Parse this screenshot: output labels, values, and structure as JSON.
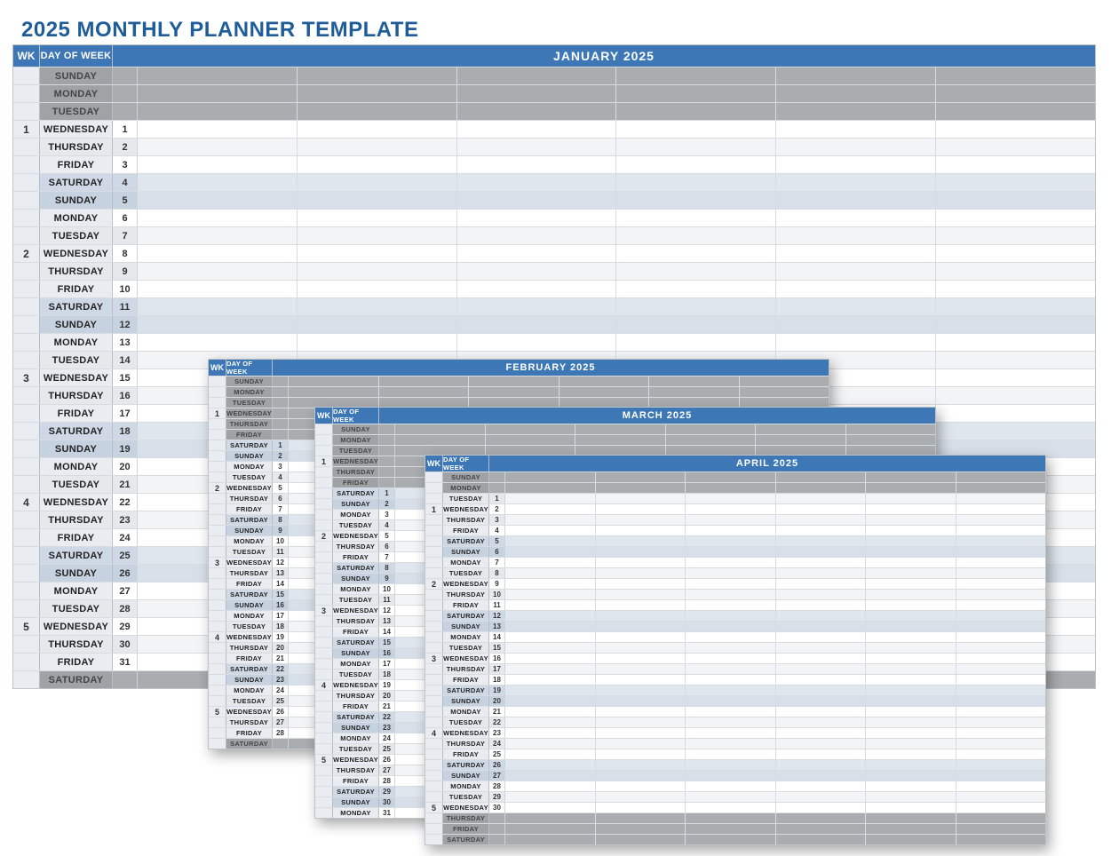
{
  "title": "2025 MONTHLY PLANNER TEMPLATE",
  "col_wk": "WK",
  "col_dow": "DAY OF WEEK",
  "slot_count": 6,
  "day_names": [
    "SUNDAY",
    "MONDAY",
    "TUESDAY",
    "WEDNESDAY",
    "THURSDAY",
    "FRIDAY",
    "SATURDAY"
  ],
  "planners": [
    {
      "id": "january",
      "class": "p0",
      "overlay": false,
      "small": false,
      "month_label": "JANUARY 2025",
      "rows": [
        {
          "wk": "",
          "dow": "SUNDAY",
          "num": "",
          "cls": "gray"
        },
        {
          "wk": "",
          "dow": "MONDAY",
          "num": "",
          "cls": "gray"
        },
        {
          "wk": "",
          "dow": "TUESDAY",
          "num": "",
          "cls": "gray"
        },
        {
          "wk": "1",
          "dow": "WEDNESDAY",
          "num": "1",
          "cls": ""
        },
        {
          "wk": "",
          "dow": "THURSDAY",
          "num": "2",
          "cls": "alt"
        },
        {
          "wk": "",
          "dow": "FRIDAY",
          "num": "3",
          "cls": ""
        },
        {
          "wk": "",
          "dow": "SATURDAY",
          "num": "4",
          "cls": "sat"
        },
        {
          "wk": "",
          "dow": "SUNDAY",
          "num": "5",
          "cls": "sun"
        },
        {
          "wk": "",
          "dow": "MONDAY",
          "num": "6",
          "cls": ""
        },
        {
          "wk": "",
          "dow": "TUESDAY",
          "num": "7",
          "cls": "alt"
        },
        {
          "wk": "2",
          "dow": "WEDNESDAY",
          "num": "8",
          "cls": ""
        },
        {
          "wk": "",
          "dow": "THURSDAY",
          "num": "9",
          "cls": "alt"
        },
        {
          "wk": "",
          "dow": "FRIDAY",
          "num": "10",
          "cls": ""
        },
        {
          "wk": "",
          "dow": "SATURDAY",
          "num": "11",
          "cls": "sat"
        },
        {
          "wk": "",
          "dow": "SUNDAY",
          "num": "12",
          "cls": "sun"
        },
        {
          "wk": "",
          "dow": "MONDAY",
          "num": "13",
          "cls": ""
        },
        {
          "wk": "",
          "dow": "TUESDAY",
          "num": "14",
          "cls": "alt"
        },
        {
          "wk": "3",
          "dow": "WEDNESDAY",
          "num": "15",
          "cls": ""
        },
        {
          "wk": "",
          "dow": "THURSDAY",
          "num": "16",
          "cls": "alt"
        },
        {
          "wk": "",
          "dow": "FRIDAY",
          "num": "17",
          "cls": ""
        },
        {
          "wk": "",
          "dow": "SATURDAY",
          "num": "18",
          "cls": "sat"
        },
        {
          "wk": "",
          "dow": "SUNDAY",
          "num": "19",
          "cls": "sun"
        },
        {
          "wk": "",
          "dow": "MONDAY",
          "num": "20",
          "cls": ""
        },
        {
          "wk": "",
          "dow": "TUESDAY",
          "num": "21",
          "cls": "alt"
        },
        {
          "wk": "4",
          "dow": "WEDNESDAY",
          "num": "22",
          "cls": ""
        },
        {
          "wk": "",
          "dow": "THURSDAY",
          "num": "23",
          "cls": "alt"
        },
        {
          "wk": "",
          "dow": "FRIDAY",
          "num": "24",
          "cls": ""
        },
        {
          "wk": "",
          "dow": "SATURDAY",
          "num": "25",
          "cls": "sat"
        },
        {
          "wk": "",
          "dow": "SUNDAY",
          "num": "26",
          "cls": "sun"
        },
        {
          "wk": "",
          "dow": "MONDAY",
          "num": "27",
          "cls": ""
        },
        {
          "wk": "",
          "dow": "TUESDAY",
          "num": "28",
          "cls": "alt"
        },
        {
          "wk": "5",
          "dow": "WEDNESDAY",
          "num": "29",
          "cls": ""
        },
        {
          "wk": "",
          "dow": "THURSDAY",
          "num": "30",
          "cls": "alt"
        },
        {
          "wk": "",
          "dow": "FRIDAY",
          "num": "31",
          "cls": ""
        },
        {
          "wk": "",
          "dow": "SATURDAY",
          "num": "",
          "cls": "gray"
        }
      ]
    },
    {
      "id": "february",
      "class": "p1",
      "overlay": true,
      "small": true,
      "month_label": "FEBRUARY 2025",
      "rows": [
        {
          "wk": "",
          "dow": "SUNDAY",
          "num": "",
          "cls": "gray"
        },
        {
          "wk": "",
          "dow": "MONDAY",
          "num": "",
          "cls": "gray"
        },
        {
          "wk": "",
          "dow": "TUESDAY",
          "num": "",
          "cls": "gray"
        },
        {
          "wk": "1",
          "dow": "WEDNESDAY",
          "num": "",
          "cls": "gray"
        },
        {
          "wk": "",
          "dow": "THURSDAY",
          "num": "",
          "cls": "gray"
        },
        {
          "wk": "",
          "dow": "FRIDAY",
          "num": "",
          "cls": "gray"
        },
        {
          "wk": "",
          "dow": "SATURDAY",
          "num": "1",
          "cls": "sat"
        },
        {
          "wk": "",
          "dow": "SUNDAY",
          "num": "2",
          "cls": "sun"
        },
        {
          "wk": "",
          "dow": "MONDAY",
          "num": "3",
          "cls": ""
        },
        {
          "wk": "",
          "dow": "TUESDAY",
          "num": "4",
          "cls": "alt"
        },
        {
          "wk": "2",
          "dow": "WEDNESDAY",
          "num": "5",
          "cls": ""
        },
        {
          "wk": "",
          "dow": "THURSDAY",
          "num": "6",
          "cls": "alt"
        },
        {
          "wk": "",
          "dow": "FRIDAY",
          "num": "7",
          "cls": ""
        },
        {
          "wk": "",
          "dow": "SATURDAY",
          "num": "8",
          "cls": "sat"
        },
        {
          "wk": "",
          "dow": "SUNDAY",
          "num": "9",
          "cls": "sun"
        },
        {
          "wk": "",
          "dow": "MONDAY",
          "num": "10",
          "cls": ""
        },
        {
          "wk": "",
          "dow": "TUESDAY",
          "num": "11",
          "cls": "alt"
        },
        {
          "wk": "3",
          "dow": "WEDNESDAY",
          "num": "12",
          "cls": ""
        },
        {
          "wk": "",
          "dow": "THURSDAY",
          "num": "13",
          "cls": "alt"
        },
        {
          "wk": "",
          "dow": "FRIDAY",
          "num": "14",
          "cls": ""
        },
        {
          "wk": "",
          "dow": "SATURDAY",
          "num": "15",
          "cls": "sat"
        },
        {
          "wk": "",
          "dow": "SUNDAY",
          "num": "16",
          "cls": "sun"
        },
        {
          "wk": "",
          "dow": "MONDAY",
          "num": "17",
          "cls": ""
        },
        {
          "wk": "",
          "dow": "TUESDAY",
          "num": "18",
          "cls": "alt"
        },
        {
          "wk": "4",
          "dow": "WEDNESDAY",
          "num": "19",
          "cls": ""
        },
        {
          "wk": "",
          "dow": "THURSDAY",
          "num": "20",
          "cls": "alt"
        },
        {
          "wk": "",
          "dow": "FRIDAY",
          "num": "21",
          "cls": ""
        },
        {
          "wk": "",
          "dow": "SATURDAY",
          "num": "22",
          "cls": "sat"
        },
        {
          "wk": "",
          "dow": "SUNDAY",
          "num": "23",
          "cls": "sun"
        },
        {
          "wk": "",
          "dow": "MONDAY",
          "num": "24",
          "cls": ""
        },
        {
          "wk": "",
          "dow": "TUESDAY",
          "num": "25",
          "cls": "alt"
        },
        {
          "wk": "5",
          "dow": "WEDNESDAY",
          "num": "26",
          "cls": ""
        },
        {
          "wk": "",
          "dow": "THURSDAY",
          "num": "27",
          "cls": "alt"
        },
        {
          "wk": "",
          "dow": "FRIDAY",
          "num": "28",
          "cls": ""
        },
        {
          "wk": "",
          "dow": "SATURDAY",
          "num": "",
          "cls": "gray"
        }
      ]
    },
    {
      "id": "march",
      "class": "p2",
      "overlay": true,
      "small": true,
      "month_label": "MARCH 2025",
      "rows": [
        {
          "wk": "",
          "dow": "SUNDAY",
          "num": "",
          "cls": "gray"
        },
        {
          "wk": "",
          "dow": "MONDAY",
          "num": "",
          "cls": "gray"
        },
        {
          "wk": "",
          "dow": "TUESDAY",
          "num": "",
          "cls": "gray"
        },
        {
          "wk": "1",
          "dow": "WEDNESDAY",
          "num": "",
          "cls": "gray"
        },
        {
          "wk": "",
          "dow": "THURSDAY",
          "num": "",
          "cls": "gray"
        },
        {
          "wk": "",
          "dow": "FRIDAY",
          "num": "",
          "cls": "gray"
        },
        {
          "wk": "",
          "dow": "SATURDAY",
          "num": "1",
          "cls": "sat"
        },
        {
          "wk": "",
          "dow": "SUNDAY",
          "num": "2",
          "cls": "sun"
        },
        {
          "wk": "",
          "dow": "MONDAY",
          "num": "3",
          "cls": ""
        },
        {
          "wk": "",
          "dow": "TUESDAY",
          "num": "4",
          "cls": "alt"
        },
        {
          "wk": "2",
          "dow": "WEDNESDAY",
          "num": "5",
          "cls": ""
        },
        {
          "wk": "",
          "dow": "THURSDAY",
          "num": "6",
          "cls": "alt"
        },
        {
          "wk": "",
          "dow": "FRIDAY",
          "num": "7",
          "cls": ""
        },
        {
          "wk": "",
          "dow": "SATURDAY",
          "num": "8",
          "cls": "sat"
        },
        {
          "wk": "",
          "dow": "SUNDAY",
          "num": "9",
          "cls": "sun"
        },
        {
          "wk": "",
          "dow": "MONDAY",
          "num": "10",
          "cls": ""
        },
        {
          "wk": "",
          "dow": "TUESDAY",
          "num": "11",
          "cls": "alt"
        },
        {
          "wk": "3",
          "dow": "WEDNESDAY",
          "num": "12",
          "cls": ""
        },
        {
          "wk": "",
          "dow": "THURSDAY",
          "num": "13",
          "cls": "alt"
        },
        {
          "wk": "",
          "dow": "FRIDAY",
          "num": "14",
          "cls": ""
        },
        {
          "wk": "",
          "dow": "SATURDAY",
          "num": "15",
          "cls": "sat"
        },
        {
          "wk": "",
          "dow": "SUNDAY",
          "num": "16",
          "cls": "sun"
        },
        {
          "wk": "",
          "dow": "MONDAY",
          "num": "17",
          "cls": ""
        },
        {
          "wk": "",
          "dow": "TUESDAY",
          "num": "18",
          "cls": "alt"
        },
        {
          "wk": "4",
          "dow": "WEDNESDAY",
          "num": "19",
          "cls": ""
        },
        {
          "wk": "",
          "dow": "THURSDAY",
          "num": "20",
          "cls": "alt"
        },
        {
          "wk": "",
          "dow": "FRIDAY",
          "num": "21",
          "cls": ""
        },
        {
          "wk": "",
          "dow": "SATURDAY",
          "num": "22",
          "cls": "sat"
        },
        {
          "wk": "",
          "dow": "SUNDAY",
          "num": "23",
          "cls": "sun"
        },
        {
          "wk": "",
          "dow": "MONDAY",
          "num": "24",
          "cls": ""
        },
        {
          "wk": "",
          "dow": "TUESDAY",
          "num": "25",
          "cls": "alt"
        },
        {
          "wk": "5",
          "dow": "WEDNESDAY",
          "num": "26",
          "cls": ""
        },
        {
          "wk": "",
          "dow": "THURSDAY",
          "num": "27",
          "cls": "alt"
        },
        {
          "wk": "",
          "dow": "FRIDAY",
          "num": "28",
          "cls": ""
        },
        {
          "wk": "",
          "dow": "SATURDAY",
          "num": "29",
          "cls": "sat"
        },
        {
          "wk": "",
          "dow": "SUNDAY",
          "num": "30",
          "cls": "sun"
        },
        {
          "wk": "",
          "dow": "MONDAY",
          "num": "31",
          "cls": ""
        }
      ]
    },
    {
      "id": "april",
      "class": "p3",
      "overlay": true,
      "small": true,
      "month_label": "APRIL 2025",
      "rows": [
        {
          "wk": "",
          "dow": "SUNDAY",
          "num": "",
          "cls": "gray"
        },
        {
          "wk": "",
          "dow": "MONDAY",
          "num": "",
          "cls": "gray"
        },
        {
          "wk": "",
          "dow": "TUESDAY",
          "num": "1",
          "cls": "alt"
        },
        {
          "wk": "1",
          "dow": "WEDNESDAY",
          "num": "2",
          "cls": ""
        },
        {
          "wk": "",
          "dow": "THURSDAY",
          "num": "3",
          "cls": "alt"
        },
        {
          "wk": "",
          "dow": "FRIDAY",
          "num": "4",
          "cls": ""
        },
        {
          "wk": "",
          "dow": "SATURDAY",
          "num": "5",
          "cls": "sat"
        },
        {
          "wk": "",
          "dow": "SUNDAY",
          "num": "6",
          "cls": "sun"
        },
        {
          "wk": "",
          "dow": "MONDAY",
          "num": "7",
          "cls": ""
        },
        {
          "wk": "",
          "dow": "TUESDAY",
          "num": "8",
          "cls": "alt"
        },
        {
          "wk": "2",
          "dow": "WEDNESDAY",
          "num": "9",
          "cls": ""
        },
        {
          "wk": "",
          "dow": "THURSDAY",
          "num": "10",
          "cls": "alt"
        },
        {
          "wk": "",
          "dow": "FRIDAY",
          "num": "11",
          "cls": ""
        },
        {
          "wk": "",
          "dow": "SATURDAY",
          "num": "12",
          "cls": "sat"
        },
        {
          "wk": "",
          "dow": "SUNDAY",
          "num": "13",
          "cls": "sun"
        },
        {
          "wk": "",
          "dow": "MONDAY",
          "num": "14",
          "cls": ""
        },
        {
          "wk": "",
          "dow": "TUESDAY",
          "num": "15",
          "cls": "alt"
        },
        {
          "wk": "3",
          "dow": "WEDNESDAY",
          "num": "16",
          "cls": ""
        },
        {
          "wk": "",
          "dow": "THURSDAY",
          "num": "17",
          "cls": "alt"
        },
        {
          "wk": "",
          "dow": "FRIDAY",
          "num": "18",
          "cls": ""
        },
        {
          "wk": "",
          "dow": "SATURDAY",
          "num": "19",
          "cls": "sat"
        },
        {
          "wk": "",
          "dow": "SUNDAY",
          "num": "20",
          "cls": "sun"
        },
        {
          "wk": "",
          "dow": "MONDAY",
          "num": "21",
          "cls": ""
        },
        {
          "wk": "",
          "dow": "TUESDAY",
          "num": "22",
          "cls": "alt"
        },
        {
          "wk": "4",
          "dow": "WEDNESDAY",
          "num": "23",
          "cls": ""
        },
        {
          "wk": "",
          "dow": "THURSDAY",
          "num": "24",
          "cls": "alt"
        },
        {
          "wk": "",
          "dow": "FRIDAY",
          "num": "25",
          "cls": ""
        },
        {
          "wk": "",
          "dow": "SATURDAY",
          "num": "26",
          "cls": "sat"
        },
        {
          "wk": "",
          "dow": "SUNDAY",
          "num": "27",
          "cls": "sun"
        },
        {
          "wk": "",
          "dow": "MONDAY",
          "num": "28",
          "cls": ""
        },
        {
          "wk": "",
          "dow": "TUESDAY",
          "num": "29",
          "cls": "alt"
        },
        {
          "wk": "5",
          "dow": "WEDNESDAY",
          "num": "30",
          "cls": ""
        },
        {
          "wk": "",
          "dow": "THURSDAY",
          "num": "",
          "cls": "gray"
        },
        {
          "wk": "",
          "dow": "FRIDAY",
          "num": "",
          "cls": "gray"
        },
        {
          "wk": "",
          "dow": "SATURDAY",
          "num": "",
          "cls": "gray"
        }
      ]
    }
  ]
}
